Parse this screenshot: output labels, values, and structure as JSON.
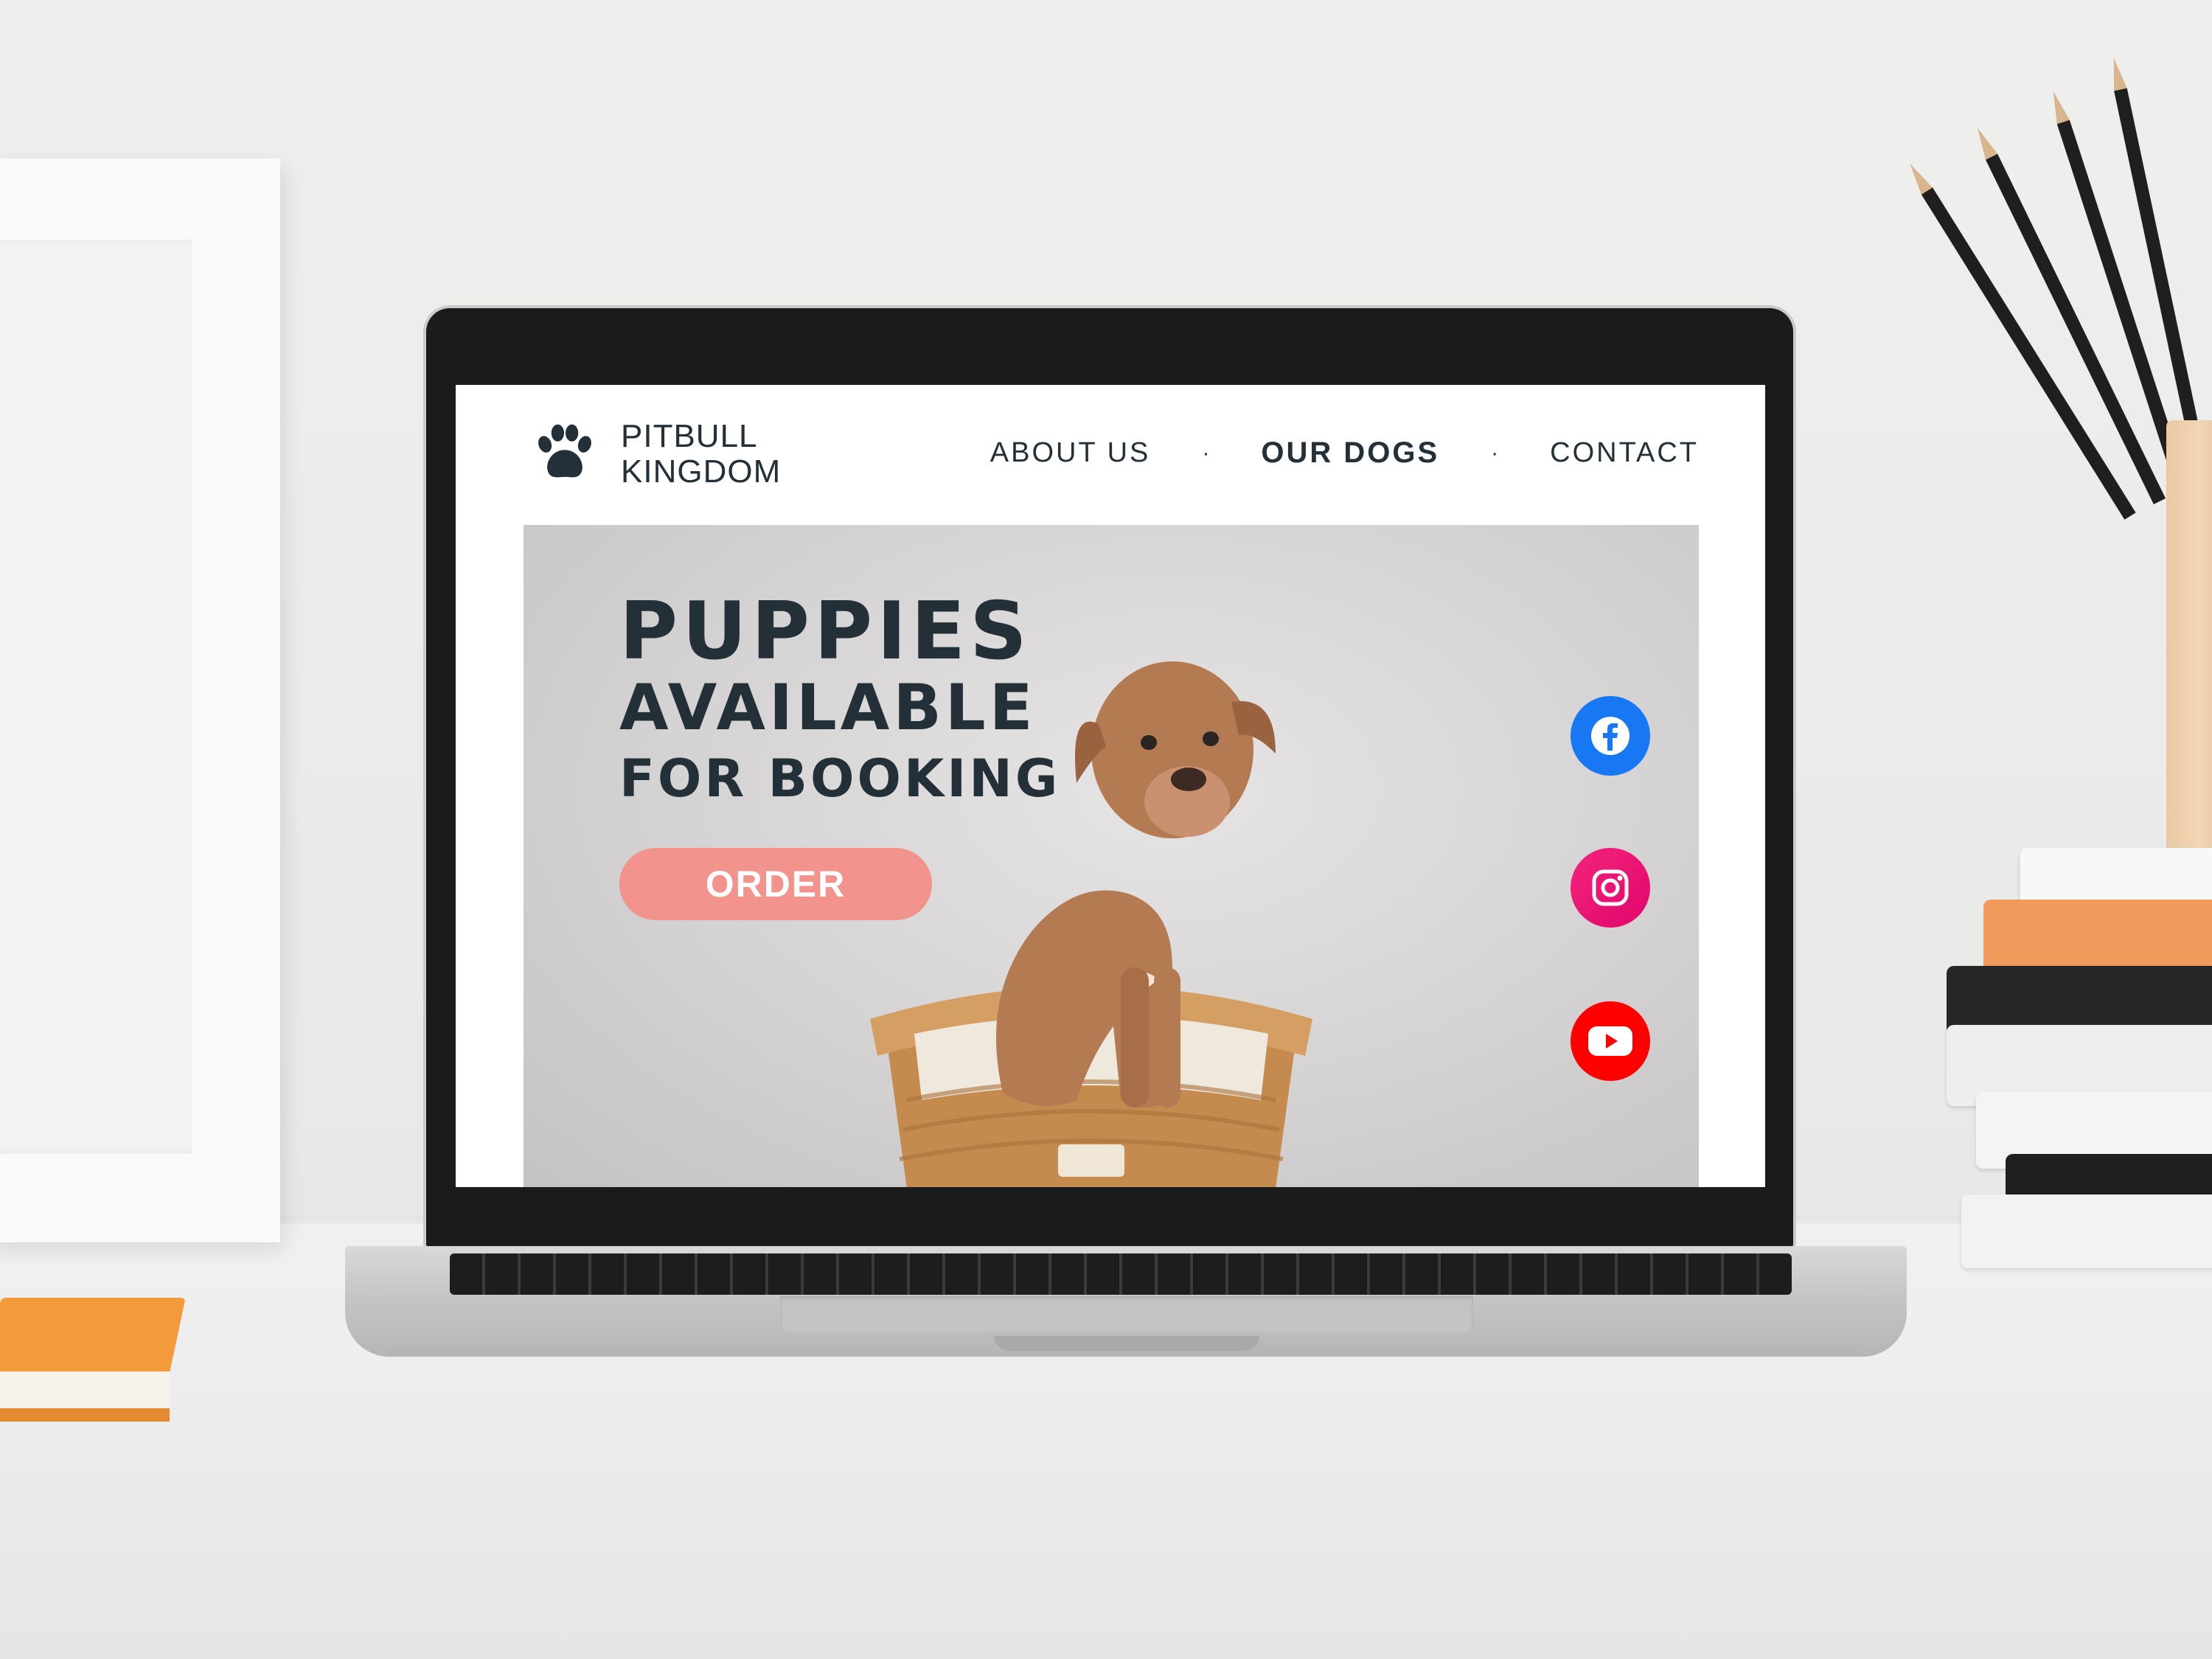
{
  "site": {
    "brand_line1": "PITBULL",
    "brand_line2": "KINGDOM",
    "nav": [
      {
        "label": "ABOUT US"
      },
      {
        "label": "OUR DOGS"
      },
      {
        "label": "CONTACT"
      }
    ],
    "nav_separator": "·",
    "hero": {
      "line1": "PUPPIES",
      "line2": "AVAILABLE",
      "line3": "FOR BOOKING",
      "cta_label": "ORDER"
    },
    "social": [
      "facebook-icon",
      "instagram-icon",
      "youtube-icon"
    ]
  },
  "colors": {
    "text_dark": "#233038",
    "cta": "#f2938d",
    "facebook": "#1877f2",
    "instagram": "#e1066b",
    "youtube": "#ff0000"
  }
}
